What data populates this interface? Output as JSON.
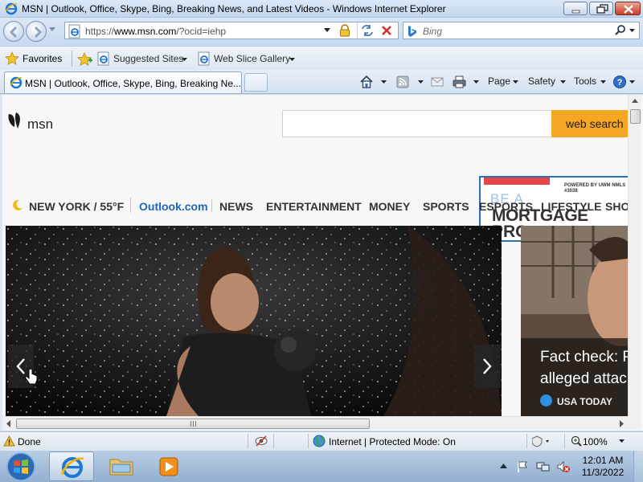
{
  "window": {
    "title": "MSN | Outlook, Office, Skype, Bing, Breaking News, and Latest Videos - Windows Internet Explorer"
  },
  "address_bar": {
    "url_prefix": "https://",
    "url_host": "www.msn.com",
    "url_rest": "/?ocid=iehp"
  },
  "search_bar": {
    "placeholder": "Bing"
  },
  "favorites_bar": {
    "favorites_label": "Favorites",
    "items": [
      {
        "label": "Suggested Sites"
      },
      {
        "label": "Web Slice Gallery"
      }
    ]
  },
  "tabs": [
    {
      "label": "MSN | Outlook, Office, Skype, Bing, Breaking Ne..."
    }
  ],
  "command_bar": {
    "page": "Page",
    "safety": "Safety",
    "tools": "Tools"
  },
  "msn": {
    "logo_text": "msn",
    "search_button": "web search",
    "weather": "NEW YORK / 55°F",
    "nav": [
      "Outlook.com",
      "NEWS",
      "ENTERTAINMENT",
      "MONEY",
      "SPORTS",
      "ESPORTS",
      "LIFESTYLE",
      "SHOP"
    ],
    "ad": {
      "tagline": "POWERED BY UWM NMLS #3038",
      "line1": "BE A",
      "line2": "MORTGAGE",
      "line3": "PRO"
    },
    "card": {
      "headline_line1": "Fact check: Pa",
      "headline_line2": "alleged attac",
      "source": "USA TODAY"
    }
  },
  "status_bar": {
    "status": "Done",
    "zone": "Internet | Protected Mode: On",
    "zoom": "100%"
  },
  "taskbar": {
    "time": "12:01 AM",
    "date": "11/3/2022"
  },
  "colors": {
    "msn_accent": "#f5a623",
    "outlook_link": "#1f66b3",
    "ad_border": "#2d6fb3"
  }
}
